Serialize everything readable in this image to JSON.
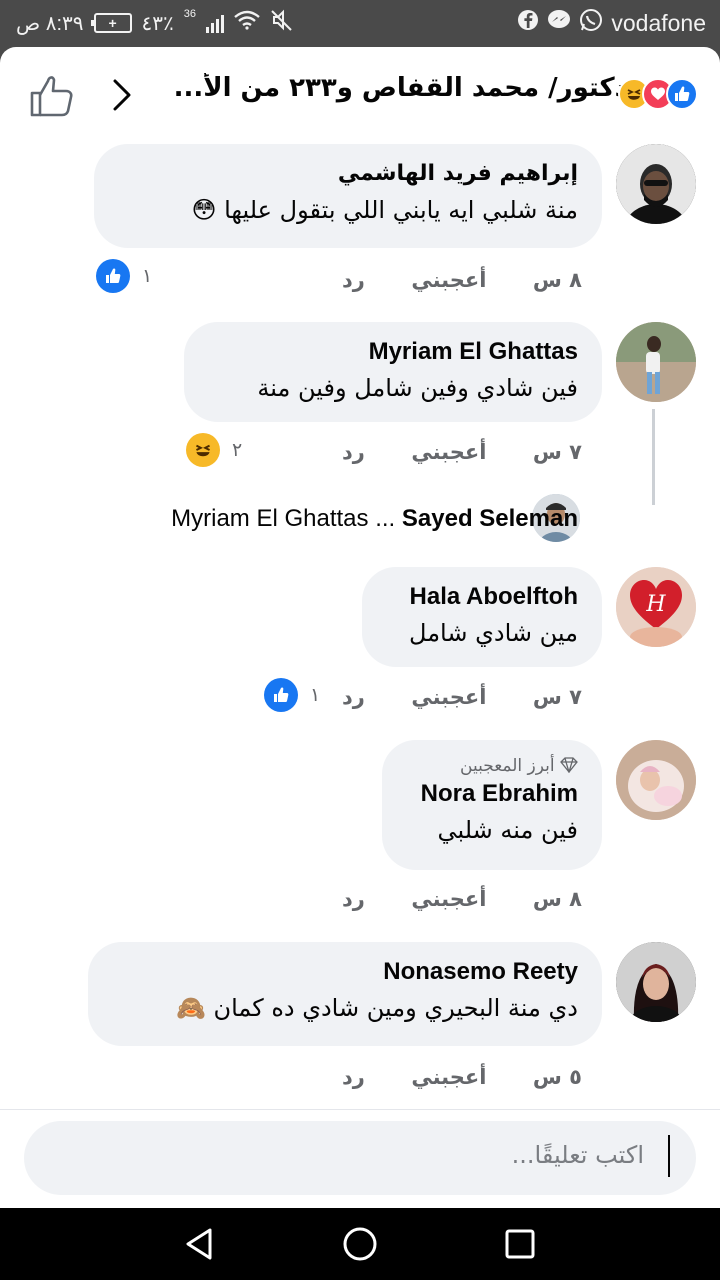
{
  "status_bar": {
    "time": "٨:٣٩ ص",
    "battery": "٤٣٪",
    "network_type": "36",
    "carrier": "vodafone",
    "icons": [
      "battery-icon",
      "signal-icon",
      "wifi-icon",
      "mute-icon",
      "facebook-icon",
      "messenger-icon",
      "whatsapp-icon"
    ]
  },
  "header": {
    "title": "دكتور/ محمد القفاص و٢٣٣ من الأ...",
    "reactions": [
      "like",
      "love",
      "haha"
    ]
  },
  "comments": [
    {
      "author": "إبراهيم فريد الهاشمي",
      "text": "منة شلبي ايه يابني اللي بتقول عليها 😳",
      "time": "٨ س",
      "like_label": "أعجبني",
      "reply_label": "رد",
      "reaction_count": "١",
      "reaction_type": "like"
    },
    {
      "author": "Myriam El Ghattas",
      "text": "فين شادي وفين شامل وفين منة",
      "time": "٧ س",
      "like_label": "أعجبني",
      "reply_label": "رد",
      "reaction_count": "٢",
      "reaction_type": "haha"
    },
    {
      "author": "Hala Aboelftoh",
      "text": "مين شادي شامل",
      "time": "٧ س",
      "like_label": "أعجبني",
      "reply_label": "رد",
      "reaction_count": "١",
      "reaction_type": "like"
    },
    {
      "author": "Nora Ebrahim",
      "badge": "أبرز المعجبين",
      "text": "فين منه شلبي",
      "time": "٨ س",
      "like_label": "أعجبني",
      "reply_label": "رد"
    },
    {
      "author": "Nonasemo Reety",
      "text": "دي منة البحيري ومين شادي ده كمان 🙈",
      "time": "٥ س",
      "like_label": "أعجبني",
      "reply_label": "رد"
    }
  ],
  "reply_preview": {
    "author": "Sayed Seleman",
    "separator": "...",
    "mention": "Myriam El Ghattas"
  },
  "composer": {
    "placeholder": "اكتب تعليقًا..."
  },
  "colors": {
    "like_blue": "#1877f2",
    "love_red": "#f33e58",
    "haha_yellow": "#f7b928",
    "bubble_bg": "#f0f2f5",
    "meta_gray": "#65676b"
  }
}
